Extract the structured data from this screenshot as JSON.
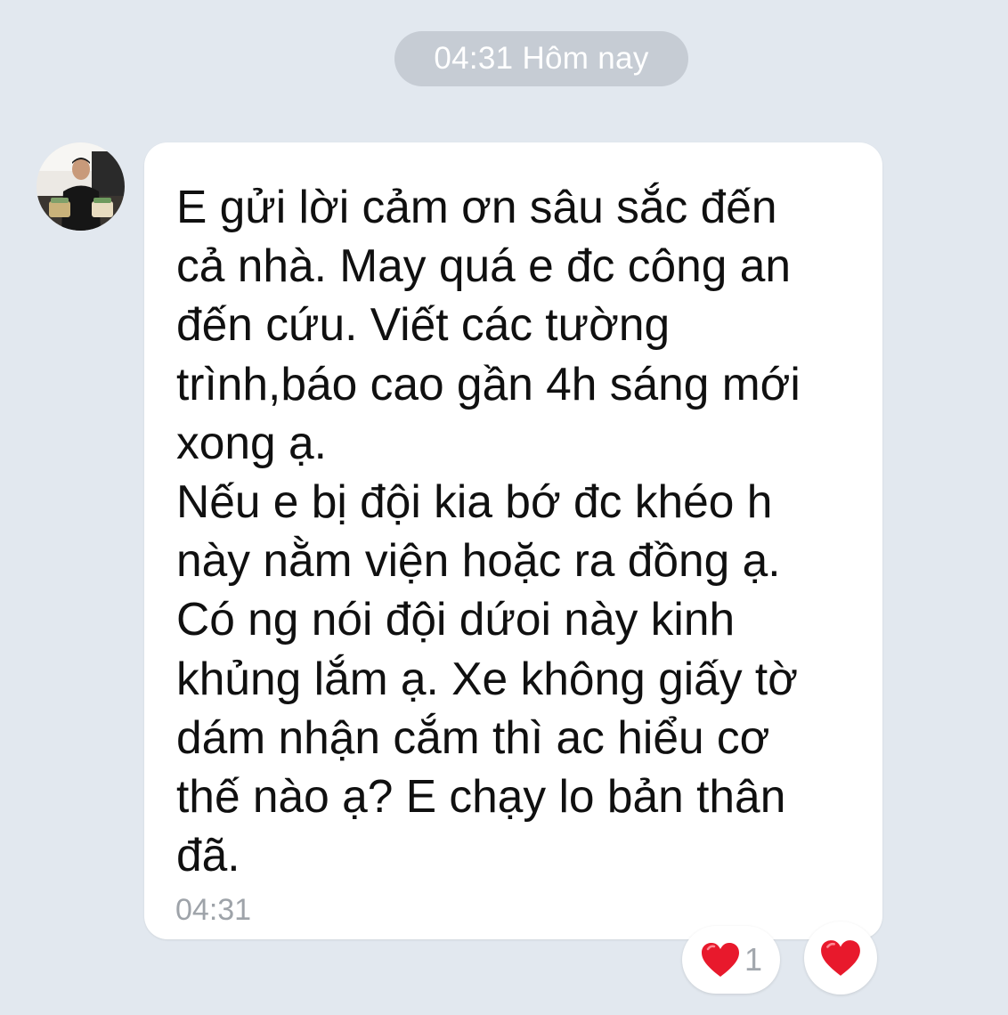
{
  "date_divider": {
    "label": "04:31 Hôm nay"
  },
  "message": {
    "sender_avatar_icon": "avatar-photo",
    "lines": [
      "E gửi lời cảm ơn sâu sắc đến",
      "cả nhà. May quá e đc công an",
      "đến cứu. Viết các tường",
      "trình,báo cao gần 4h sáng mới",
      "xong ạ.",
      "Nếu e bị đội kia bớ đc khéo h",
      "này nằm viện hoặc ra đồng ạ.",
      "Có ng nói đội dứoi này kinh",
      "khủng lắm ạ. Xe không giấy tờ",
      "dám nhận cắm thì ac hiểu cơ",
      "thế nào ạ? E chạy lo bản thân",
      "đã."
    ],
    "time": "04:31"
  },
  "reactions": {
    "heart_icon": "heart-icon",
    "heart_count": "1",
    "react_button_icon": "heart-icon"
  },
  "colors": {
    "background": "#e2e8ef",
    "bubble": "#ffffff",
    "heart": "#e8192c"
  }
}
